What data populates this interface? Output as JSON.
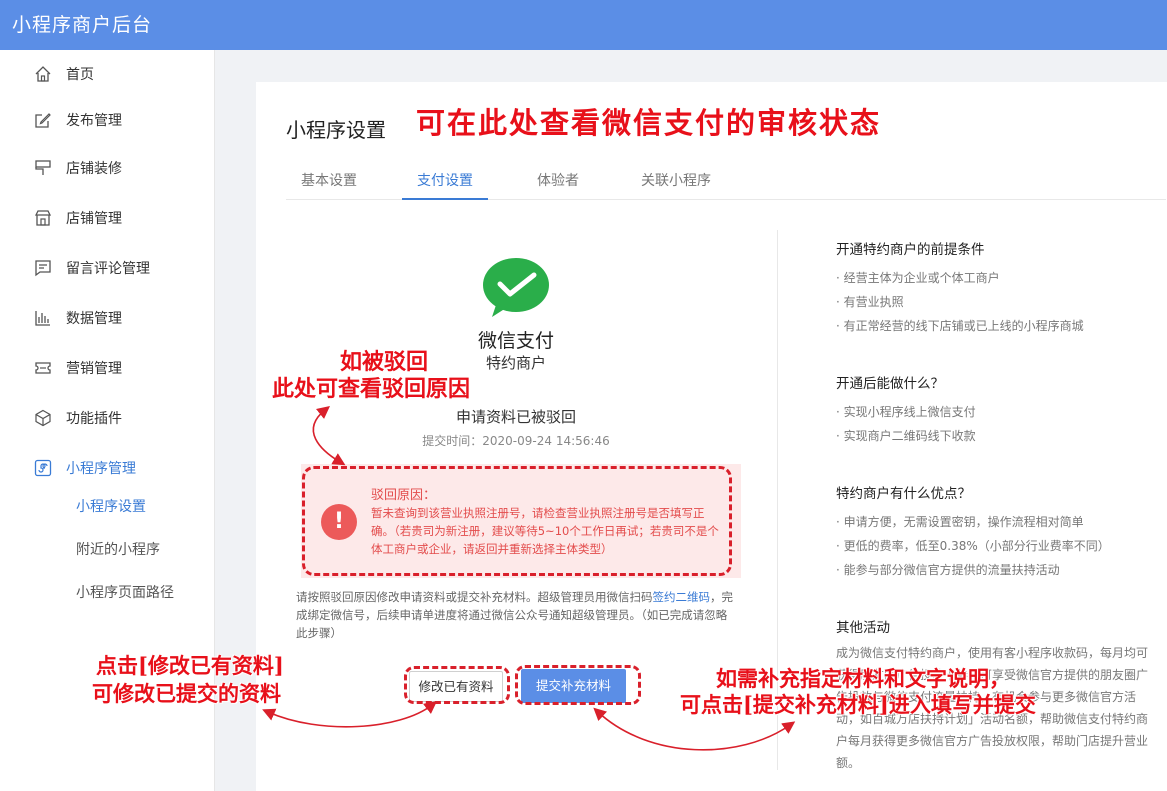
{
  "app": {
    "title": "小程序商户后台"
  },
  "sidebar": {
    "items": [
      {
        "label": "首页",
        "icon": "home-icon"
      },
      {
        "label": "发布管理",
        "icon": "edit-icon"
      },
      {
        "label": "店铺装修",
        "icon": "brush-icon"
      },
      {
        "label": "店铺管理",
        "icon": "store-icon"
      },
      {
        "label": "留言评论管理",
        "icon": "comment-icon"
      },
      {
        "label": "数据管理",
        "icon": "chart-icon"
      },
      {
        "label": "营销管理",
        "icon": "ticket-icon"
      },
      {
        "label": "功能插件",
        "icon": "cube-icon"
      },
      {
        "label": "小程序管理",
        "icon": "miniprogram-icon"
      }
    ],
    "sub_items": [
      {
        "label": "小程序设置"
      },
      {
        "label": "附近的小程序"
      },
      {
        "label": "小程序页面路径"
      }
    ]
  },
  "page": {
    "title": "小程序设置",
    "tabs": [
      {
        "label": "基本设置"
      },
      {
        "label": "支付设置"
      },
      {
        "label": "体验者"
      },
      {
        "label": "关联小程序"
      }
    ]
  },
  "payment": {
    "name": "微信支付",
    "merchant_type": "特约商户",
    "status": "申请资料已被驳回",
    "submit_time": "提交时间：2020-09-24 14:56:46",
    "reject_title": "驳回原因：",
    "reject_reason": "暂未查询到该营业执照注册号，请检查营业执照注册号是否填写正确。（若贵司为新注册，建议等待5~10个工作日再试；若贵司不是个体工商户或企业，请返回并重新选择主体类型）",
    "hint_before_link": "请按照驳回原因修改申请资料或提交补充材料。超级管理员用微信扫码",
    "hint_link": "签约二维码",
    "hint_after_link": "，完成绑定微信号，后续申请单进度将通过微信公众号通知超级管理员。（如已完成请忽略此步骤）",
    "edit_button": "修改已有资料",
    "submit_button": "提交补充材料"
  },
  "right_panel": {
    "sections": [
      {
        "title": "开通特约商户的前提条件",
        "lines": [
          "· 经营主体为企业或个体工商户",
          "· 有营业执照",
          "· 有正常经营的线下店铺或已上线的小程序商城"
        ]
      },
      {
        "title": "开通后能做什么？",
        "lines": [
          "· 实现小程序线上微信支付",
          "· 实现商户二维码线下收款"
        ]
      },
      {
        "title": "特约商户有什么优点？",
        "lines": [
          "· 申请方便，无需设置密钥，操作流程相对简单",
          "· 更低的费率，低至0.38%（小部分行业费率不同）",
          "· 能参与部分微信官方提供的流量扶持活动"
        ]
      }
    ],
    "other": {
      "title": "其他活动",
      "text": "成为微信支付特约商户，使用有客小程序收款码，每月均可获得朋友圈广告投放卡券，可享受微信官方提供的朋友圈广告投放与微信支付流量扶持，有机会参与更多微信官方活动，如百城万店扶持计划」活动名额，帮助微信支付特约商户每月获得更多微信官方广告投放权限，帮助门店提升营业额。"
    }
  },
  "annotations": {
    "top": "可在此处查看微信支付的审核状态",
    "reject_line1": "如被驳回",
    "reject_line2": "此处可查看驳回原因",
    "edit_line1": "点击[修改已有资料]",
    "edit_line2": "可修改已提交的资料",
    "submit_line1": "如需补充指定材料和文字说明，",
    "submit_line2": "可点击[提交补充材料]进入填写并提交"
  },
  "colors": {
    "topbar": "#5b8ee6",
    "accent": "#3a7bd5",
    "annotation": "#e8101a",
    "wechat_green": "#2aae4a"
  }
}
